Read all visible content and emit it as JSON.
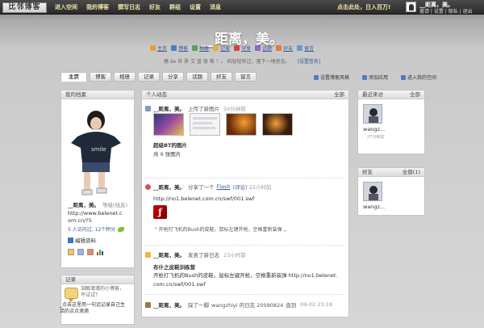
{
  "topbar": {
    "logo": "比邻博客",
    "nav": [
      "进入空间",
      "我的博客",
      "撰写日志",
      "好友",
      "群组",
      "设置",
      "消息"
    ],
    "promo_link": "点击此处，日入百万!",
    "user_name": "__距离，美。",
    "user_links": "邀请 | 设置 | 隐私 | 退出"
  },
  "header": {
    "title": "__距离，美。",
    "quicklinks": [
      "主页",
      "博客",
      "相册",
      "记录",
      "分享",
      "话题",
      "好友",
      "留言"
    ],
    "subtitle": "偶 de 世 界 艾 蓝 很 难 ！。 风轻轻吹过，落下一地思念。",
    "subtitle_link": "[设置签名]"
  },
  "tabs": [
    "主页",
    "博客",
    "相册",
    "记录",
    "分享",
    "话题",
    "好友",
    "留言"
  ],
  "right_links": [
    "设置博客风格",
    "添加应用",
    "进入我的空间"
  ],
  "profile": {
    "header": "我的档案",
    "name": "__距离，美。",
    "note": "等级(线友)",
    "url": "http://www.belenet.com.cn/?5",
    "stats": "5 人访问过, 12个积分",
    "edit": "编辑资料"
  },
  "records": {
    "header": "记录",
    "text": "泪眼潸潸的小博客，不试试？",
    "sub": "_点击这里用一句话记录自己生活的点点滴滴"
  },
  "feed": {
    "header": "个人动态",
    "more": "全部",
    "items": [
      {
        "who": "__距离，美。",
        "action": "上传了新图片",
        "time": "50分钟前",
        "title": "超级BT的图片",
        "sub_pre": "共",
        "sub_num": "8",
        "sub_post": "张图片"
      },
      {
        "who": "__距离，美。",
        "action": "分享了一个",
        "link": "Flash",
        "reply": "(评论)",
        "time": "22小时前",
        "url": "http://no1.belenet.com.cn/swf/001.swf",
        "quote": "开枪打飞机的Bush的皮鞋，鼠标左键开枪，空格重新装弹"
      },
      {
        "who": "__距离，美。",
        "action": "发表了新日志",
        "time": "23小时前",
        "title": "布什之皮鞋训练营",
        "desc": "开枪打飞机的Bush的皮鞋，鼠标左键开枪，空格重新装弹 http://no1.belenet.com.cn/swf/001.swf"
      },
      {
        "who": "__距离，美。",
        "action": "踩了一脚",
        "target": "wangzhiyi 的日志 20090824",
        "extra": "直到",
        "time": "09-02 23:18"
      }
    ]
  },
  "recent_visitors": {
    "header": "最近来访",
    "more": "全部",
    "name": "wangz...",
    "time": "27分钟前"
  },
  "friends": {
    "header": "好友",
    "more": "全部(1)",
    "name": "wangz..."
  },
  "colors": {
    "accent": "#3b5998",
    "topbar": "#2a2a2a",
    "nav_text": "#f0e6a8"
  }
}
